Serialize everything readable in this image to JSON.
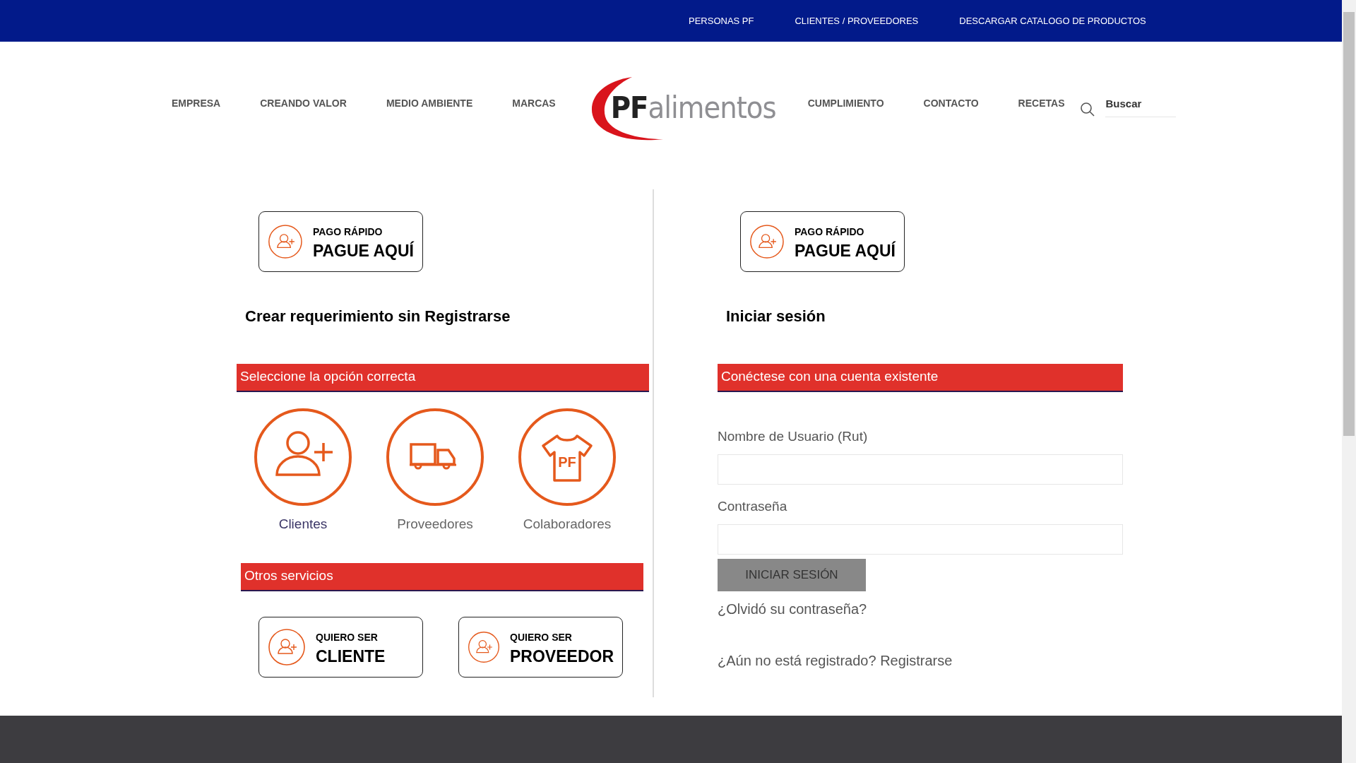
{
  "top_bar": {
    "links": [
      "PERSONAS PF",
      "CLIENTES / PROVEEDORES",
      "DESCARGAR CATALOGO DE PRODUCTOS"
    ]
  },
  "nav": {
    "left": [
      "EMPRESA",
      "CREANDO VALOR",
      "MEDIO AMBIENTE",
      "MARCAS"
    ],
    "logo": "**PF**alimentos",
    "right": [
      "CUMPLIMIENTO",
      "CONTACTO",
      "RECETAS"
    ],
    "search": {
      "placeholder": "Buscar"
    }
  },
  "left": {
    "pay_card": {
      "small": "PAGO RÁPIDO",
      "big": "PAGUE AQUÍ"
    },
    "heading": "Crear requerimiento sin Registrarse",
    "options_bar": "Seleccione la opción correcta",
    "options": [
      {
        "kind": "person",
        "label": "Clientes",
        "selected": true
      },
      {
        "kind": "truck",
        "label": "Proveedores",
        "selected": false
      },
      {
        "kind": "shirt",
        "label": "Colaboradores",
        "selected": false,
        "print": "PF"
      }
    ],
    "other_bar": "Otros servicios",
    "service_cards": [
      {
        "small": "QUIERO SER",
        "big": "CLIENTE"
      },
      {
        "small": "QUIERO SER",
        "big": "PROVEEDOR"
      }
    ]
  },
  "right": {
    "pay_card": {
      "small": "PAGO RÁPIDO",
      "big": "PAGUE AQUÍ"
    },
    "heading": "Iniciar sesión",
    "bar": "Conéctese con una cuenta existente",
    "fields": [
      {
        "label": "Nombre de Usuario (Rut)"
      },
      {
        "label": "Contraseña"
      }
    ],
    "button": "INICIAR SESIÓN",
    "forgot_link": "¿Olvidó su contraseña?",
    "register_link": "¿Aún no está registrado? Registrarse"
  }
}
